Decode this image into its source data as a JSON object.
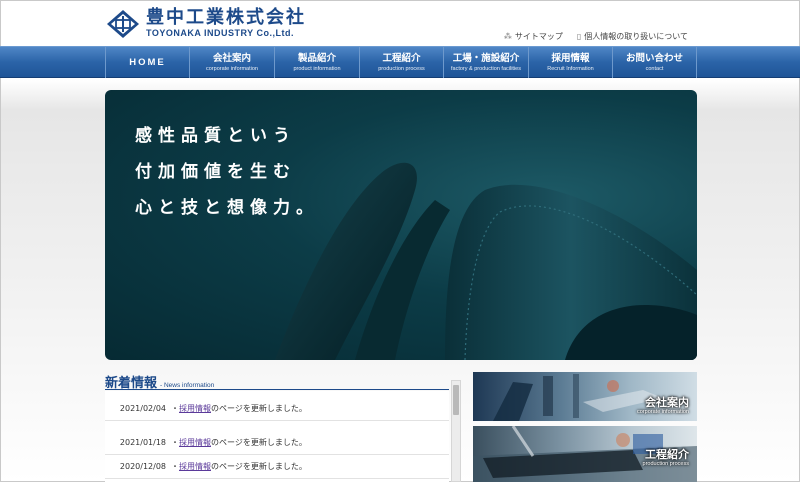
{
  "header": {
    "logo_jp": "豊中工業株式会社",
    "logo_en": "TOYONAKA INDUSTRY Co.,Ltd.",
    "utility_links": [
      "サイトマップ",
      "個人情報の取り扱いについて"
    ]
  },
  "nav": {
    "home": "HOME",
    "items": [
      {
        "jp": "会社案内",
        "en": "corporate information"
      },
      {
        "jp": "製品紹介",
        "en": "product information"
      },
      {
        "jp": "工程紹介",
        "en": "production process"
      },
      {
        "jp": "工場・施設紹介",
        "en": "factory & production facilities"
      },
      {
        "jp": "採用情報",
        "en": "Recruit Information"
      },
      {
        "jp": "お問い合わせ",
        "en": "contact"
      }
    ]
  },
  "hero": {
    "lines": [
      "感性品質という",
      "付加価値を生む",
      "心と技と想像力。"
    ]
  },
  "news": {
    "title": "新着情報",
    "subtitle": "- News information",
    "items": [
      {
        "date": "2021/02/04",
        "prefix": "・",
        "link": "採用情報",
        "rest": "のページを更新しました。"
      },
      {
        "date": "2021/01/18",
        "prefix": "・",
        "link": "採用情報",
        "rest": "のページを更新しました。"
      },
      {
        "date": "2020/12/08",
        "prefix": "・",
        "link": "採用情報",
        "rest": "のページを更新しました。"
      }
    ]
  },
  "banners": [
    {
      "jp": "会社案内",
      "en": "corporate information"
    },
    {
      "jp": "工程紹介",
      "en": "production process"
    }
  ],
  "colors": {
    "brand": "#1d4a8a",
    "nav": "#2b64a8",
    "hero": "#0c3c47",
    "link": "#5b3a9a"
  }
}
